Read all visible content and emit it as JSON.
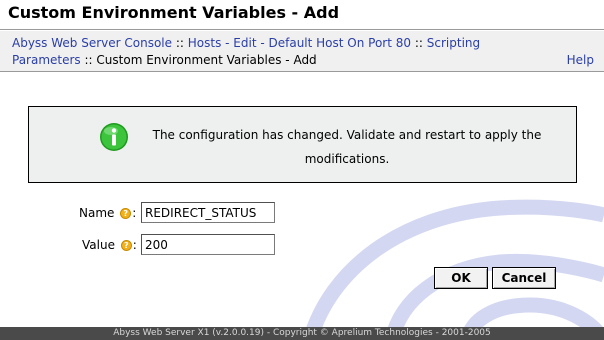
{
  "page": {
    "title": "Custom Environment Variables - Add"
  },
  "breadcrumb": {
    "items": [
      {
        "label": "Abyss Web Server Console",
        "link": true
      },
      {
        "label": "Hosts - Edit - Default Host On Port 80",
        "link": true
      },
      {
        "label": "Scripting Parameters",
        "link": true
      },
      {
        "label": "Custom Environment Variables - Add",
        "link": false
      }
    ],
    "separator": "::"
  },
  "help": {
    "label": "Help"
  },
  "notice": {
    "icon": "info-icon",
    "icon_color": "#2fb52f",
    "text": "The configuration has changed. Validate and restart to apply the modifications."
  },
  "form": {
    "name": {
      "label": "Name",
      "help_icon": "help-icon",
      "value": "REDIRECT_STATUS"
    },
    "value": {
      "label": "Value",
      "help_icon": "help-icon",
      "value": "200"
    }
  },
  "buttons": {
    "ok": "OK",
    "cancel": "Cancel"
  },
  "footer": {
    "text": "Abyss Web Server X1 (v.2.0.0.19) - Copyright © Aprelium Technologies - 2001-2005"
  },
  "colors": {
    "link": "#2a3ea6",
    "nav_bg": "#f0f0f0",
    "notice_bg": "#eef0f0",
    "footer_bg": "#4a4a4a",
    "watermark": "#cfd3ef"
  }
}
